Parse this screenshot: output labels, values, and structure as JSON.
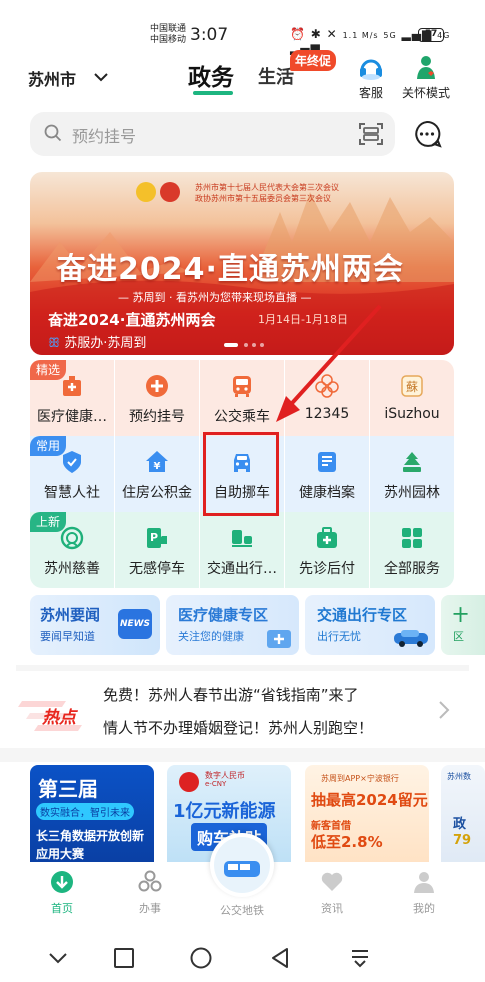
{
  "status_bar": {
    "carrier1": "中国联通",
    "carrier2": "中国移动",
    "time": "3:07",
    "net_speed": "1.1 M/s",
    "signal1": "5G",
    "signal2": "4G",
    "battery": "57"
  },
  "header": {
    "city": "苏州市",
    "tab_active": "政务",
    "tab_other": "生活",
    "tab_badge": "年终促",
    "customer_service": "客服",
    "care_mode": "关怀模式"
  },
  "search": {
    "placeholder": "预约挂号"
  },
  "banner": {
    "top_line1": "苏州市第十七届人民代表大会第三次会议",
    "top_line2": "政协苏州市第十五届委员会第三次会议",
    "title": "奋进2024·直通苏州两会",
    "subtitle": "— 苏周到 · 看苏州为您带来现场直播 —",
    "caption": "奋进2024·直通苏州两会",
    "date": "1月14日-1月18日",
    "source": "苏服办·苏周到"
  },
  "grid": {
    "tags": {
      "row1": "精选",
      "row2": "常用",
      "row3": "上新"
    },
    "row1": [
      {
        "label": "医疗健康…",
        "icon": "hospital-icon"
      },
      {
        "label": "预约挂号",
        "icon": "medical-cross-icon"
      },
      {
        "label": "公交乘车",
        "icon": "bus-icon"
      },
      {
        "label": "12345",
        "icon": "hotline-flower-icon"
      },
      {
        "label": "iSuzhou",
        "icon": "isuzhou-logo-icon"
      }
    ],
    "row2": [
      {
        "label": "智慧人社",
        "icon": "shield-icon"
      },
      {
        "label": "住房公积金",
        "icon": "house-yuan-icon"
      },
      {
        "label": "自助挪车",
        "icon": "car-icon"
      },
      {
        "label": "健康档案",
        "icon": "health-record-icon"
      },
      {
        "label": "苏州园林",
        "icon": "garden-icon"
      }
    ],
    "row3": [
      {
        "label": "苏州慈善",
        "icon": "charity-icon"
      },
      {
        "label": "无感停车",
        "icon": "parking-icon"
      },
      {
        "label": "交通出行…",
        "icon": "traffic-icon"
      },
      {
        "label": "先诊后付",
        "icon": "medical-kit-icon"
      },
      {
        "label": "全部服务",
        "icon": "all-services-icon"
      }
    ]
  },
  "features": [
    {
      "title": "苏州要闻",
      "sub": "要闻早知道",
      "badge": "NEWS",
      "color": "#1f5fbf"
    },
    {
      "title": "医疗健康专区",
      "sub": "关注您的健康",
      "color": "#2a7ad6"
    },
    {
      "title": "交通出行专区",
      "sub": "出行无忧",
      "color": "#1f78d1"
    },
    {
      "title": "十",
      "sub": "区",
      "color": "#22a060"
    }
  ],
  "hot": {
    "logo": "热点",
    "line1": "免费！苏州人春节出游“省钱指南”来了",
    "line2": "情人节不办理婚姻登记！苏州人别跑空！"
  },
  "promos": [
    {
      "line1": "第三届",
      "line2": "数实融合，智引未来",
      "line3": "长三角数据开放创新",
      "line4": "应用大赛"
    },
    {
      "line1": "数字人民币",
      "line2": "e-CNY",
      "line3": "1亿元新能源",
      "line4": "购车补贴"
    },
    {
      "line1": "苏周到APP×宁波银行",
      "line2": "抽最高2024留元",
      "line3": "新客首借",
      "line4": "低至2.8%"
    },
    {
      "line1": "苏州数",
      "line2": "政",
      "line3": "79"
    }
  ],
  "bottom_nav": [
    {
      "label": "首页",
      "active": true
    },
    {
      "label": "办事"
    },
    {
      "label": "公交地铁"
    },
    {
      "label": "资讯"
    },
    {
      "label": "我的"
    }
  ]
}
